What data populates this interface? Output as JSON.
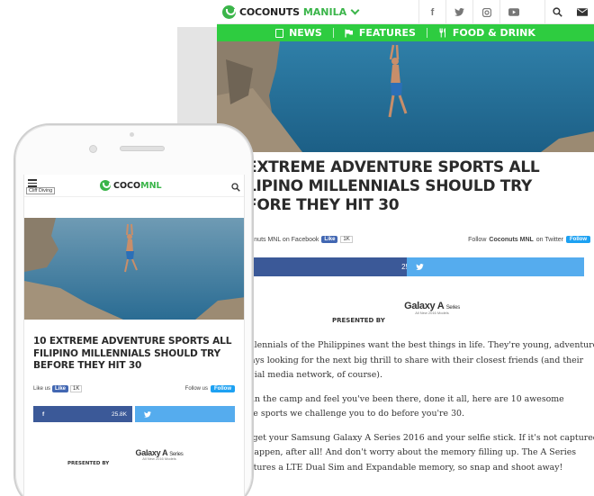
{
  "colors": {
    "brand_green": "#3bb54a",
    "nav_green": "#2ecc40",
    "facebook_blue": "#3b5998",
    "twitter_blue": "#55acee"
  },
  "desktop": {
    "logo": {
      "part1": "COCONUTS",
      "part2": "MANILA",
      "icon": "coconuts-leaf-logo"
    },
    "social_icons": [
      "f",
      "twitter-icon",
      "instagram-icon",
      "youtube-icon"
    ],
    "tools": [
      "search-icon",
      "mail-icon"
    ],
    "nav": [
      {
        "label": "NEWS",
        "icon": "document-icon"
      },
      {
        "label": "FEATURES",
        "icon": "flag-icon"
      },
      {
        "label": "FOOD & DRINK",
        "icon": "cutlery-icon"
      }
    ],
    "title_lines": [
      "EXTREME ADVENTURE SPORTS ALL",
      "LIPINO MILLENNIALS SHOULD TRY",
      "FORE THEY HIT 30"
    ],
    "like": {
      "prefix": "oconuts MNL on Facebook",
      "button": "Like",
      "count": "1K"
    },
    "follow": {
      "prefix": "Follow",
      "account": "Coconuts MNL",
      "suffix": "on Twitter",
      "button": "Follow"
    },
    "fb_share_count": "25.8K",
    "sponsor": {
      "brand": "Galaxy A",
      "series": "Series",
      "sub": "All New 2016 Models",
      "presented_by": "PRESENTED BY"
    },
    "body_paragraphs": [
      [
        "Millennials of the Philippines want the best things in life. They're young, adventurous",
        "lways looking for the next big thrill to share with their closest friends (and their",
        "social media network, of course)."
      ],
      [
        "re in the camp and feel you've been there, done it all, here are 10 awesome",
        "ture sports we challenge you to do before you're 30."
      ],
      [
        "forget your Samsung Galaxy A Series 2016 and your selfie stick. If it's not captured,",
        "'t happen, after all! And don't worry about the memory filling up. The A Series",
        "features a LTE Dual Sim and Expandable memory, so snap and shoot away!"
      ]
    ]
  },
  "phone": {
    "tag": "Cliff Diving",
    "logo": {
      "part1": "COCO",
      "part2": "MNL"
    },
    "title_lines": [
      "10 EXTREME ADVENTURE SPORTS ALL",
      "FILIPINO MILLENNIALS SHOULD TRY",
      "BEFORE THEY HIT 30"
    ],
    "like": {
      "prefix": "Like us",
      "button": "Like",
      "count": "1K"
    },
    "follow": {
      "prefix": "Follow us",
      "button": "Follow"
    },
    "fb_share_label": "f",
    "fb_share_count": "25.8K",
    "sponsor": {
      "brand": "Galaxy A",
      "series": "Series",
      "sub": "All New 2016 Models",
      "presented_by": "PRESENTED BY"
    }
  }
}
